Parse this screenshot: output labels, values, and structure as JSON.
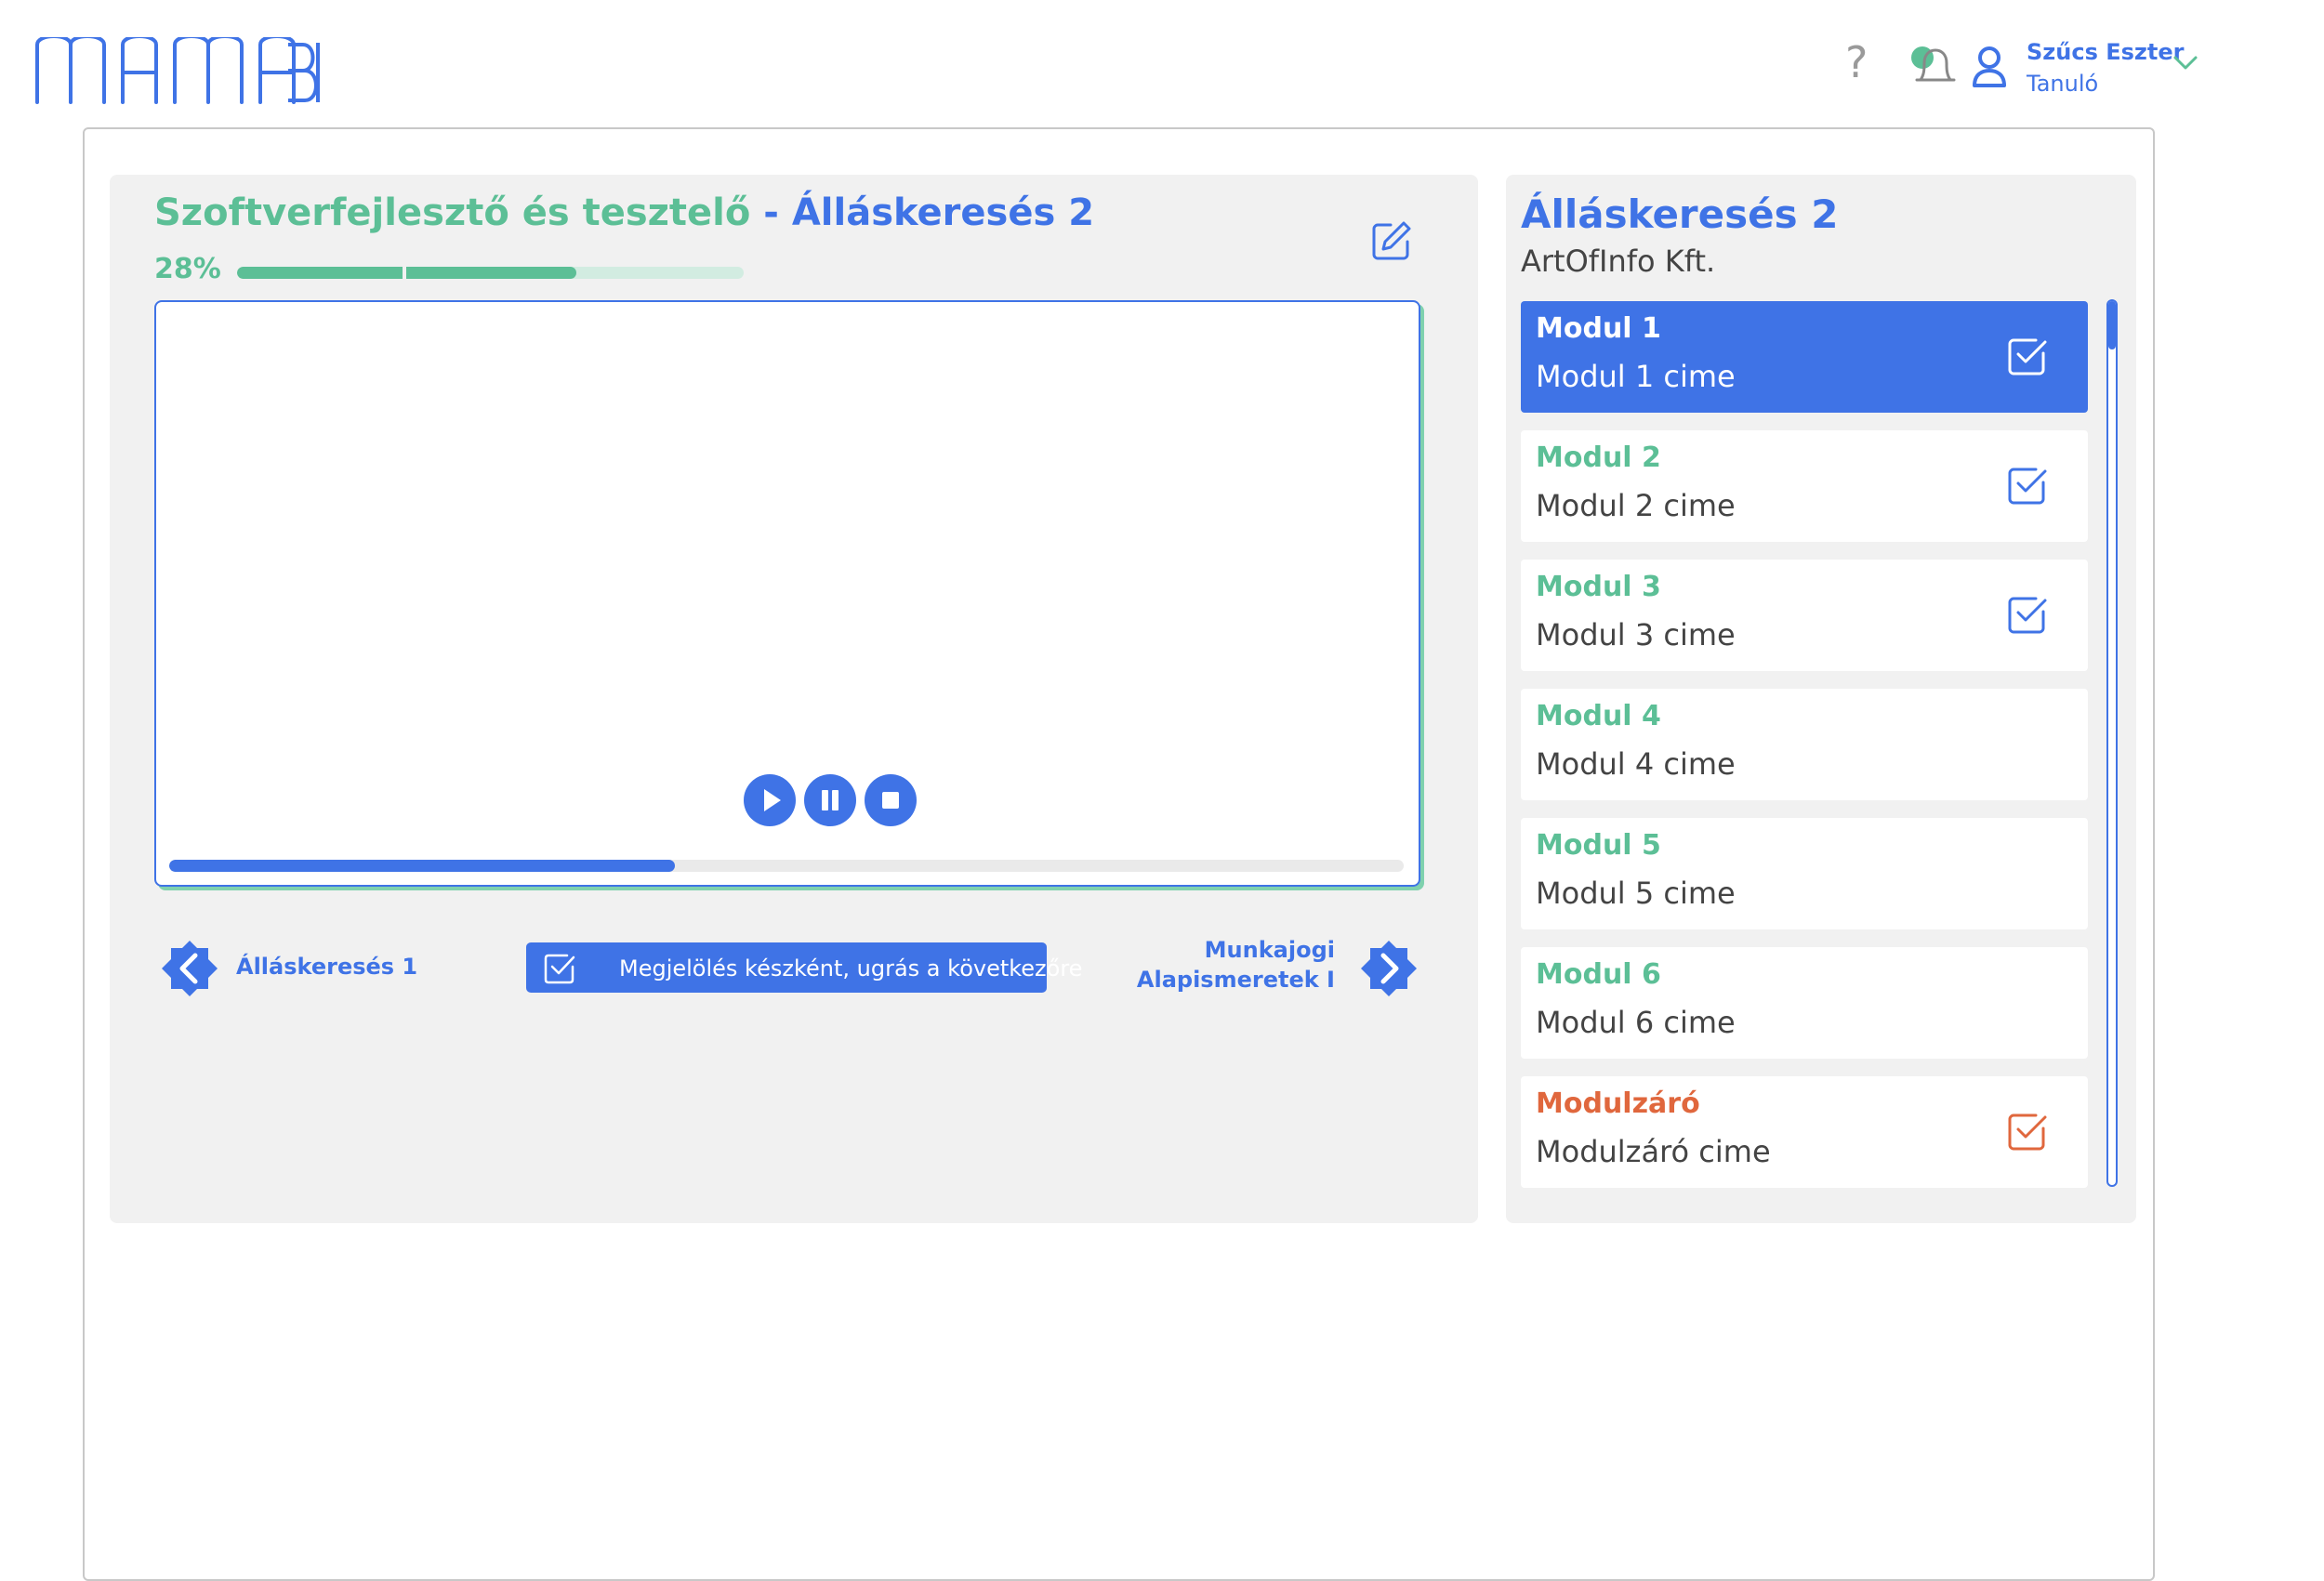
{
  "brand": {
    "logo_icon": "mamabi-logo",
    "accent": "#3f73e6",
    "green": "#5cbf96",
    "orange": "#e0673d"
  },
  "header": {
    "help_glyph": "?",
    "user_name": "Szűcs Eszter",
    "user_role": "Tanuló"
  },
  "lesson": {
    "course_name": "Szoftverfejlesztő és tesztelő",
    "separator": " - ",
    "lesson_name": "Álláskeresés 2",
    "progress_label": "28%",
    "progress_value": 0.67
  },
  "player": {
    "progress_value": 0.41
  },
  "navigation": {
    "prev_label": "Álláskeresés 1",
    "mark_label": "Megjelölés készként, ugrás a következőre",
    "next_label_line1": "Munkajogi",
    "next_label_line2": "Alapismeretek I"
  },
  "sidebar": {
    "title": "Álláskeresés 2",
    "company": "ArtOfInfo Kft.",
    "modules": [
      {
        "title": "Modul 1",
        "subtitle": "Modul 1 cime",
        "checked": true,
        "active": true
      },
      {
        "title": "Modul 2",
        "subtitle": "Modul 2 cime",
        "checked": true
      },
      {
        "title": "Modul 3",
        "subtitle": "Modul 3 cime",
        "checked": true
      },
      {
        "title": "Modul 4",
        "subtitle": "Modul 4 cime",
        "checked": false
      },
      {
        "title": "Modul 5",
        "subtitle": "Modul 5 cime",
        "checked": false
      },
      {
        "title": "Modul 6",
        "subtitle": "Modul 6 cime",
        "checked": false
      },
      {
        "title": "Modulzáró",
        "subtitle": "Modulzáró cime",
        "checked": true,
        "closing": true
      }
    ]
  }
}
